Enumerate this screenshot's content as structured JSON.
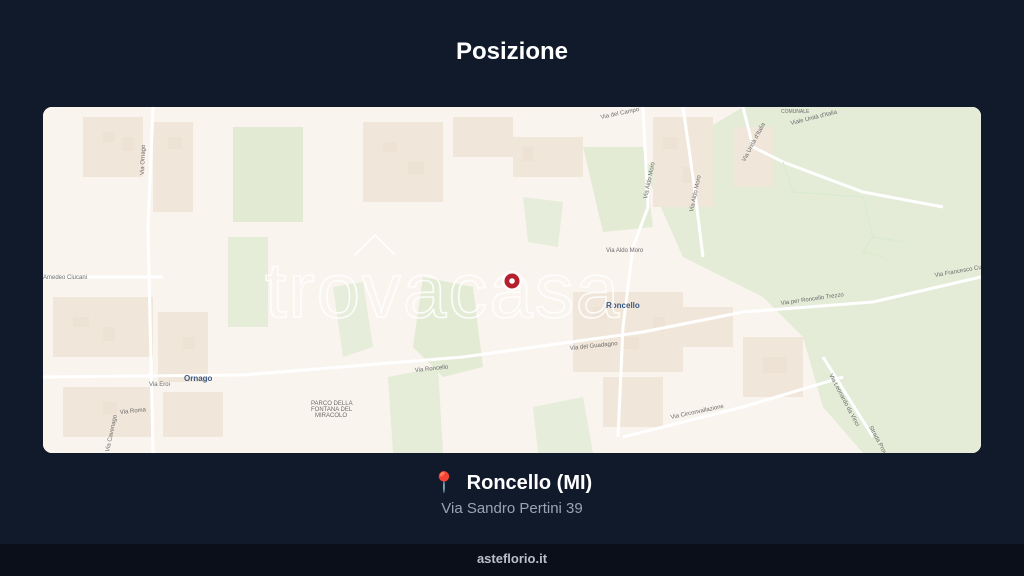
{
  "header": {
    "title": "Posizione"
  },
  "map": {
    "watermark": "trovacasa",
    "labels": {
      "via_ornago": "Via Ornago",
      "amedeo": "Amedeo Ciucani",
      "ornago": "Ornago",
      "via_eroi": "Via Eroi",
      "via_roma": "Via Roma",
      "via_cavenago": "Via Cavenago",
      "parco_1": "PARCO DELLA",
      "parco_2": "FONTANA DEL",
      "parco_3": "MIRACOLO",
      "via_roncello": "Via Roncello",
      "roncello": "Roncello",
      "via_guadagno": "Via del Guadagno",
      "via_circonvallazione": "Via Circonvallazione",
      "via_aldo_moro_1": "Via Aldo Moro",
      "via_aldo_moro_2": "Via Aldo Moro",
      "via_campo": "Via del Campo",
      "comunale": "COMUNALE",
      "via_unita_1": "Viale Unità d'Italia",
      "via_unita_2": "Via Unità d'Italia",
      "via_moro_top": "Via Aldo Moro",
      "via_francesco": "Via Francesco Cu",
      "via_per_roncello": "Via per Roncello Trezzo",
      "via_leonardo": "Via Leonardo da Vinci",
      "strada_prov": "Strada Prov"
    },
    "marker_color": "#b3202e"
  },
  "location": {
    "pin_icon": "📍",
    "city": "Roncello (MI)",
    "address": "Via Sandro Pertini 39"
  },
  "footer": {
    "brand": "asteflorio.it"
  }
}
